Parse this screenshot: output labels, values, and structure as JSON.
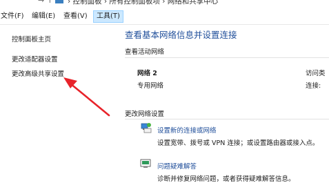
{
  "address_bar": {
    "nav_glyph": "→ ↑",
    "breadcrumb": "›  控制面板  ›  所有控制面板项  ›  网络和共享中心"
  },
  "menu": {
    "items": [
      "文件(F)",
      "编辑(E)",
      "查看(V)",
      "工具(T)"
    ],
    "active_index": 3
  },
  "sidebar": {
    "items": [
      "控制面板主页",
      "更改适配器设置",
      "更改高级共享设置"
    ]
  },
  "main": {
    "title": "查看基本网络信息并设置连接",
    "active_networks_heading": "查看活动网络",
    "network": {
      "name": "网络 2",
      "type": "专用网络",
      "access_type_label": "访问类",
      "connection_label": "连接:"
    },
    "change_settings_heading": "更改网络设置",
    "tasks": [
      {
        "title": "设置新的连接或网络",
        "desc": "设置宽带、拨号或 VPN 连接；或设置路由器或接入点。"
      },
      {
        "title": "问题疑难解答",
        "desc": "诊断并修复网络问题，或者获得疑难解答信息。"
      }
    ]
  },
  "colors": {
    "link": "#1f4e9a",
    "menu_active_bg": "#cce8ff",
    "arrow": "#e8232a"
  }
}
